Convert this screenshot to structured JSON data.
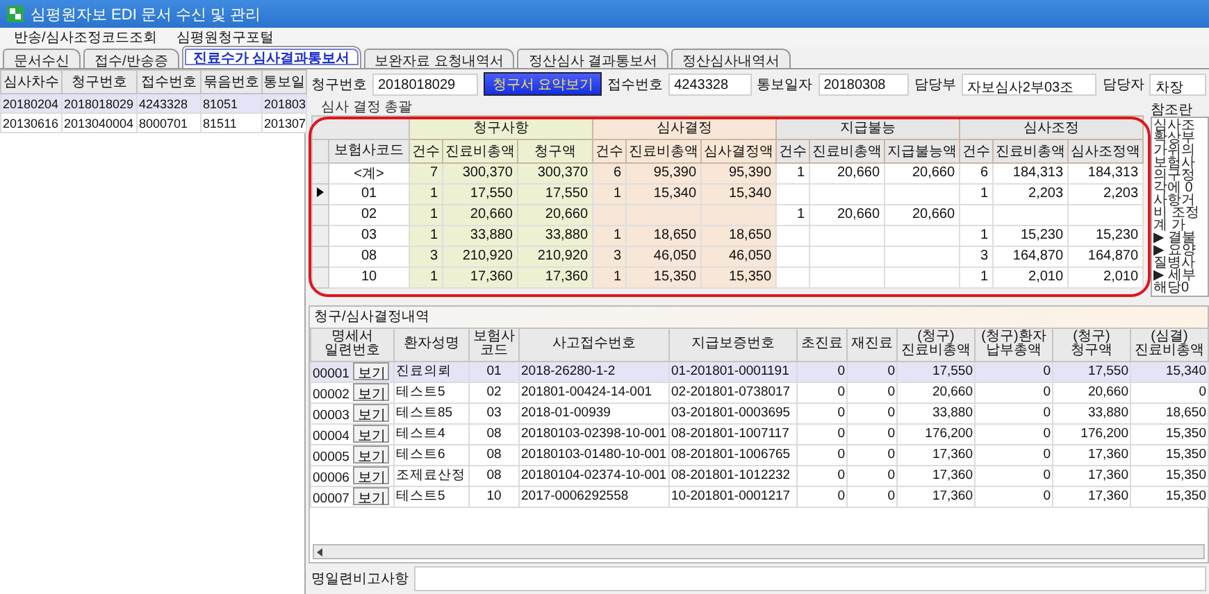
{
  "window": {
    "title": "심평원자보 EDI 문서 수신 및 관리"
  },
  "menu": [
    "반송/심사조정코드조회",
    "심평원청구포털"
  ],
  "tabs": [
    {
      "label": "문서수신",
      "selected": false
    },
    {
      "label": "접수/반송증",
      "selected": false
    },
    {
      "label": "진료수가 심사결과통보서",
      "selected": true
    },
    {
      "label": "보완자료 요청내역서",
      "selected": false
    },
    {
      "label": "정산심사 결과통보서",
      "selected": false
    },
    {
      "label": "정산심사내역서",
      "selected": false
    }
  ],
  "claim_list": {
    "columns": [
      "심사차수",
      "청구번호",
      "접수번호",
      "묶음번호",
      "통보일"
    ],
    "rows": [
      {
        "cells": [
          "20180204",
          "2018018029",
          "4243328",
          "81051",
          "201803"
        ],
        "selected": true
      },
      {
        "cells": [
          "20130616",
          "2013040004",
          "8000701",
          "81511",
          "201307"
        ],
        "selected": false
      }
    ]
  },
  "header_fields": [
    {
      "kind": "field",
      "label": "청구번호",
      "value": "2018018029"
    },
    {
      "kind": "button",
      "label": "청구서 요약보기"
    },
    {
      "kind": "field",
      "label": "접수번호",
      "value": "4243328"
    },
    {
      "kind": "field",
      "label": "통보일자",
      "value": "20180308"
    },
    {
      "kind": "field",
      "label": "담당부",
      "value": "자보심사2부03조"
    },
    {
      "kind": "field",
      "label": "담당자",
      "value": "차장"
    }
  ],
  "summary": {
    "title": "심사 결정 총괄",
    "code_header": "보험사코드",
    "groups": [
      {
        "label": "청구사항",
        "color": "#eef0d2",
        "columns": [
          "건수",
          "진료비총액",
          "청구액"
        ]
      },
      {
        "label": "심사결정",
        "color": "#f8e6d6",
        "columns": [
          "건수",
          "진료비총액",
          "심사결정액"
        ]
      },
      {
        "label": "지급불능",
        "color": "#e6e6e6",
        "columns": [
          "건수",
          "진료비총액",
          "지급불능액"
        ]
      },
      {
        "label": "심사조정",
        "color": "#e6e6e6",
        "columns": [
          "건수",
          "진료비총액",
          "심사조정액"
        ]
      }
    ],
    "rows": [
      {
        "code": "<계>",
        "current": false,
        "claim": [
          "7",
          "300,370",
          "300,370"
        ],
        "decision": [
          "6",
          "95,390",
          "95,390"
        ],
        "unpayable": [
          "1",
          "20,660",
          "20,660"
        ],
        "adjustment": [
          "6",
          "184,313",
          "184,313"
        ]
      },
      {
        "code": "01",
        "current": true,
        "claim": [
          "1",
          "17,550",
          "17,550"
        ],
        "decision": [
          "1",
          "15,340",
          "15,340"
        ],
        "adjustment": [
          "1",
          "2,203",
          "2,203"
        ]
      },
      {
        "code": "02",
        "current": false,
        "claim": [
          "1",
          "20,660",
          "20,660"
        ],
        "unpayable": [
          "1",
          "20,660",
          "20,660"
        ]
      },
      {
        "code": "03",
        "current": false,
        "claim": [
          "1",
          "33,880",
          "33,880"
        ],
        "decision": [
          "1",
          "18,650",
          "18,650"
        ],
        "adjustment": [
          "1",
          "15,230",
          "15,230"
        ]
      },
      {
        "code": "08",
        "current": false,
        "claim": [
          "3",
          "210,920",
          "210,920"
        ],
        "decision": [
          "3",
          "46,050",
          "46,050"
        ],
        "adjustment": [
          "3",
          "164,870",
          "164,870"
        ]
      },
      {
        "code": "10",
        "current": false,
        "claim": [
          "1",
          "17,360",
          "17,360"
        ],
        "decision": [
          "1",
          "15,350",
          "15,350"
        ],
        "adjustment": [
          "1",
          "2,010",
          "2,010"
        ]
      }
    ]
  },
  "reference": {
    "title": "참조란",
    "lines": [
      "심사조",
      "확상부",
      "가위의",
      "보험사",
      "의구정",
      "각에 0",
      "사항거",
      "비 조정",
      "계 가",
      "▶ 결불",
      "▶ 요양",
      "질병사",
      "▶ 세부",
      "해당0"
    ]
  },
  "details": {
    "title": "청구/심사결정내역",
    "columns": [
      "명세서\n일련번호",
      "환자성명",
      "보험사\n코드",
      "사고접수번호",
      "지급보증번호",
      "초진료",
      "재진료",
      "(청구)\n진료비총액",
      "(청구)환자\n납부총액",
      "(청구)\n청구액",
      "(심결)\n진료비총액"
    ],
    "rows": [
      {
        "cells": [
          "00001",
          "진료의뢰",
          "01",
          "2018-26280-1-2",
          "01-201801-0001191",
          "0",
          "0",
          "17,550",
          "0",
          "17,550",
          "15,340"
        ],
        "action": "보기",
        "selected": true
      },
      {
        "cells": [
          "00002",
          "테스트5",
          "02",
          "201801-00424-14-001",
          "02-201801-0738017",
          "0",
          "0",
          "20,660",
          "0",
          "20,660",
          "0"
        ],
        "action": "보기",
        "selected": false
      },
      {
        "cells": [
          "00003",
          "테스트85",
          "03",
          "2018-01-00939",
          "03-201801-0003695",
          "0",
          "0",
          "33,880",
          "0",
          "33,880",
          "18,650"
        ],
        "action": "보기",
        "selected": false
      },
      {
        "cells": [
          "00004",
          "테스트4",
          "08",
          "20180103-02398-10-001",
          "08-201801-1007117",
          "0",
          "0",
          "176,200",
          "0",
          "176,200",
          "15,350"
        ],
        "action": "보기",
        "selected": false
      },
      {
        "cells": [
          "00005",
          "테스트6",
          "08",
          "20180103-01480-10-001",
          "08-201801-1006765",
          "0",
          "0",
          "17,360",
          "0",
          "17,360",
          "15,350"
        ],
        "action": "보기",
        "selected": false
      },
      {
        "cells": [
          "00006",
          "조제료산정",
          "08",
          "20180104-02374-10-001",
          "08-201801-1012232",
          "0",
          "0",
          "17,360",
          "0",
          "17,360",
          "15,350"
        ],
        "action": "보기",
        "selected": false
      },
      {
        "cells": [
          "00007",
          "테스트5",
          "10",
          "2017-0006292558",
          "10-201801-0001217",
          "0",
          "0",
          "17,360",
          "0",
          "17,360",
          "15,350"
        ],
        "action": "보기",
        "selected": false
      }
    ]
  },
  "remark": {
    "label": "명일련비고사항"
  }
}
